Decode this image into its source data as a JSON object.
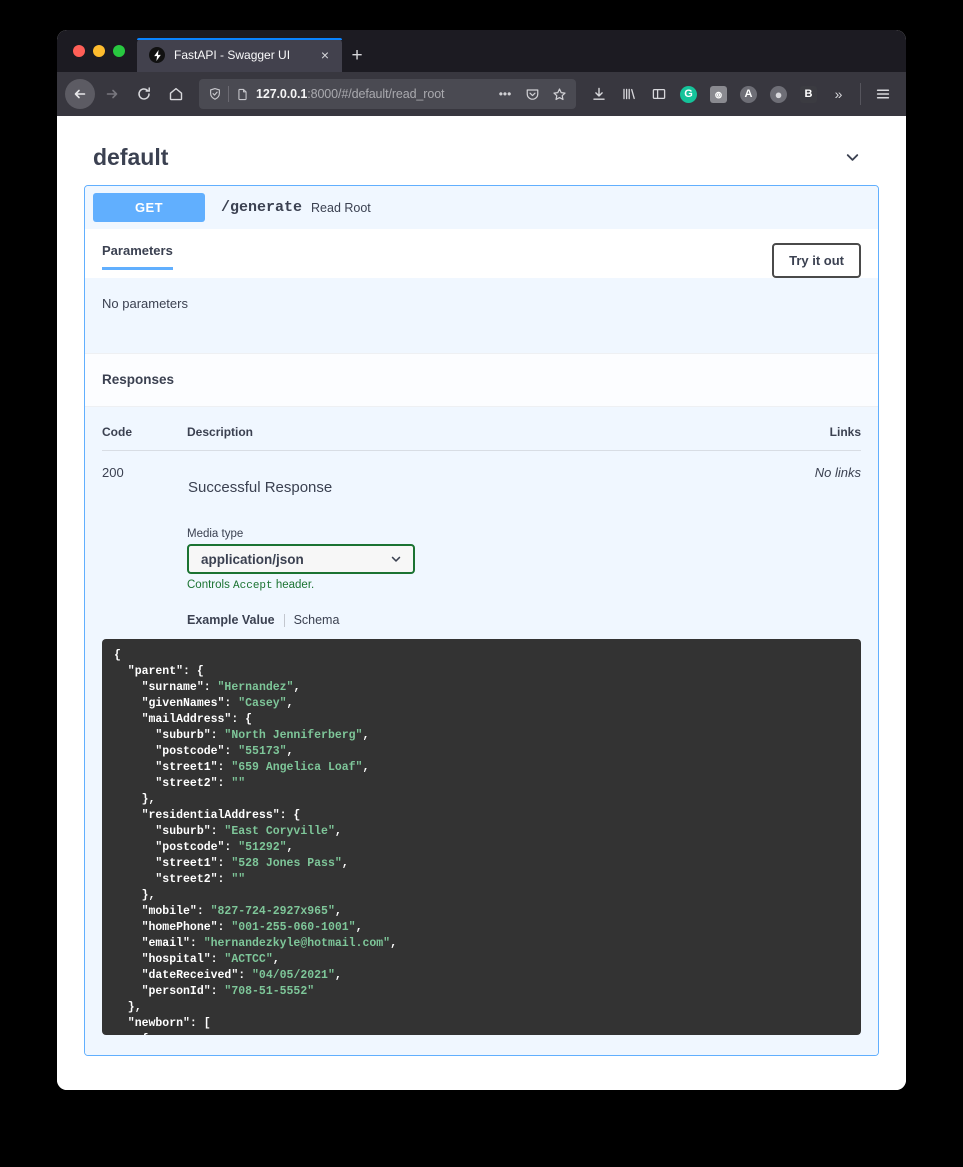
{
  "browser": {
    "tab": {
      "title": "FastAPI - Swagger UI",
      "favicon": "lightning-bolt-icon",
      "close_label": "×"
    },
    "new_tab_label": "+",
    "nav": {
      "back_label": "←",
      "forward_label": "→",
      "reload_label": "⟳",
      "home_label": "⌂"
    },
    "url": {
      "host": "127.0.0.1",
      "rest": ":8000/#/default/read_root",
      "shield_icon": "shield-icon",
      "page_icon": "page-icon",
      "more_label": "•••",
      "pocket_icon": "pocket-icon",
      "bookmark_icon": "star-icon"
    },
    "extensions": [
      {
        "name": "downloads-icon",
        "glyph": "↓",
        "kind": "glyph"
      },
      {
        "name": "library-icon",
        "glyph": "|||\\",
        "kind": "glyph"
      },
      {
        "name": "sidebar-icon",
        "glyph": "▤",
        "kind": "glyph"
      },
      {
        "name": "grammarly-icon",
        "glyph": "G",
        "kind": "circle",
        "bg": "#15c39a",
        "fg": "#ffffff"
      },
      {
        "name": "extension-figure-icon",
        "glyph": "๏",
        "kind": "square",
        "bg": "#8a8a90",
        "fg": "#ffffff"
      },
      {
        "name": "adblock-icon",
        "glyph": "A",
        "kind": "circle",
        "bg": "#6e6e76",
        "fg": "#ffffff"
      },
      {
        "name": "privacy-badger-icon",
        "glyph": "●",
        "kind": "circle",
        "bg": "#6e6e76",
        "fg": "#d8d8dc"
      },
      {
        "name": "bitwarden-icon",
        "glyph": "B",
        "kind": "square",
        "bg": "#3b3b41",
        "fg": "#ffffff"
      },
      {
        "name": "overflow-chevrons-icon",
        "glyph": "»",
        "kind": "glyph"
      }
    ],
    "menu_label": "☰"
  },
  "page": {
    "section": {
      "title": "default",
      "collapse_icon": "chevron-down-icon"
    },
    "operation": {
      "method": "GET",
      "path": "/generate",
      "summary": "Read Root",
      "tabs": {
        "parameters": "Parameters"
      },
      "try_it_out": "Try it out",
      "no_parameters": "No parameters"
    },
    "responses": {
      "title": "Responses",
      "columns": {
        "code": "Code",
        "description": "Description",
        "links": "Links"
      },
      "rows": [
        {
          "code": "200",
          "description": "Successful Response",
          "links": "No links",
          "media_type_label": "Media type",
          "media_type_value": "application/json",
          "controls_prefix": "Controls",
          "controls_code": "Accept",
          "controls_suffix": "header.",
          "example_tab": "Example Value",
          "schema_tab": "Schema"
        }
      ]
    },
    "example_json": {
      "lines": [
        [
          {
            "t": "{",
            "c": "k"
          }
        ],
        [
          {
            "t": "  \"parent\": {",
            "c": "k"
          }
        ],
        [
          {
            "t": "    \"surname\": ",
            "c": "k"
          },
          {
            "t": "\"Hernandez\"",
            "c": "s"
          },
          {
            "t": ",",
            "c": "k"
          }
        ],
        [
          {
            "t": "    \"givenNames\": ",
            "c": "k"
          },
          {
            "t": "\"Casey\"",
            "c": "s"
          },
          {
            "t": ",",
            "c": "k"
          }
        ],
        [
          {
            "t": "    \"mailAddress\": {",
            "c": "k"
          }
        ],
        [
          {
            "t": "      \"suburb\": ",
            "c": "k"
          },
          {
            "t": "\"North Jenniferberg\"",
            "c": "s"
          },
          {
            "t": ",",
            "c": "k"
          }
        ],
        [
          {
            "t": "      \"postcode\": ",
            "c": "k"
          },
          {
            "t": "\"55173\"",
            "c": "s"
          },
          {
            "t": ",",
            "c": "k"
          }
        ],
        [
          {
            "t": "      \"street1\": ",
            "c": "k"
          },
          {
            "t": "\"659 Angelica Loaf\"",
            "c": "s"
          },
          {
            "t": ",",
            "c": "k"
          }
        ],
        [
          {
            "t": "      \"street2\": ",
            "c": "k"
          },
          {
            "t": "\"\"",
            "c": "s"
          }
        ],
        [
          {
            "t": "    },",
            "c": "k"
          }
        ],
        [
          {
            "t": "    \"residentialAddress\": {",
            "c": "k"
          }
        ],
        [
          {
            "t": "      \"suburb\": ",
            "c": "k"
          },
          {
            "t": "\"East Coryville\"",
            "c": "s"
          },
          {
            "t": ",",
            "c": "k"
          }
        ],
        [
          {
            "t": "      \"postcode\": ",
            "c": "k"
          },
          {
            "t": "\"51292\"",
            "c": "s"
          },
          {
            "t": ",",
            "c": "k"
          }
        ],
        [
          {
            "t": "      \"street1\": ",
            "c": "k"
          },
          {
            "t": "\"528 Jones Pass\"",
            "c": "s"
          },
          {
            "t": ",",
            "c": "k"
          }
        ],
        [
          {
            "t": "      \"street2\": ",
            "c": "k"
          },
          {
            "t": "\"\"",
            "c": "s"
          }
        ],
        [
          {
            "t": "    },",
            "c": "k"
          }
        ],
        [
          {
            "t": "    \"mobile\": ",
            "c": "k"
          },
          {
            "t": "\"827-724-2927x965\"",
            "c": "s"
          },
          {
            "t": ",",
            "c": "k"
          }
        ],
        [
          {
            "t": "    \"homePhone\": ",
            "c": "k"
          },
          {
            "t": "\"001-255-060-1001\"",
            "c": "s"
          },
          {
            "t": ",",
            "c": "k"
          }
        ],
        [
          {
            "t": "    \"email\": ",
            "c": "k"
          },
          {
            "t": "\"hernandezkyle@hotmail.com\"",
            "c": "s"
          },
          {
            "t": ",",
            "c": "k"
          }
        ],
        [
          {
            "t": "    \"hospital\": ",
            "c": "k"
          },
          {
            "t": "\"ACTCC\"",
            "c": "s"
          },
          {
            "t": ",",
            "c": "k"
          }
        ],
        [
          {
            "t": "    \"dateReceived\": ",
            "c": "k"
          },
          {
            "t": "\"04/05/2021\"",
            "c": "s"
          },
          {
            "t": ",",
            "c": "k"
          }
        ],
        [
          {
            "t": "    \"personId\": ",
            "c": "k"
          },
          {
            "t": "\"708-51-5552\"",
            "c": "s"
          }
        ],
        [
          {
            "t": "  },",
            "c": "k"
          }
        ],
        [
          {
            "t": "  \"newborn\": [",
            "c": "k"
          }
        ],
        [
          {
            "t": "    {",
            "c": "k"
          }
        ]
      ]
    }
  },
  "colors": {
    "get_badge": "#61affe",
    "opblock_border": "#61affe",
    "opblock_bg": "#f0f7ff",
    "text": "#3b4151",
    "select_border": "#1b7332",
    "code_bg": "#333333",
    "code_string": "#7ec699",
    "tab_active_underline": "#0a84ff"
  }
}
